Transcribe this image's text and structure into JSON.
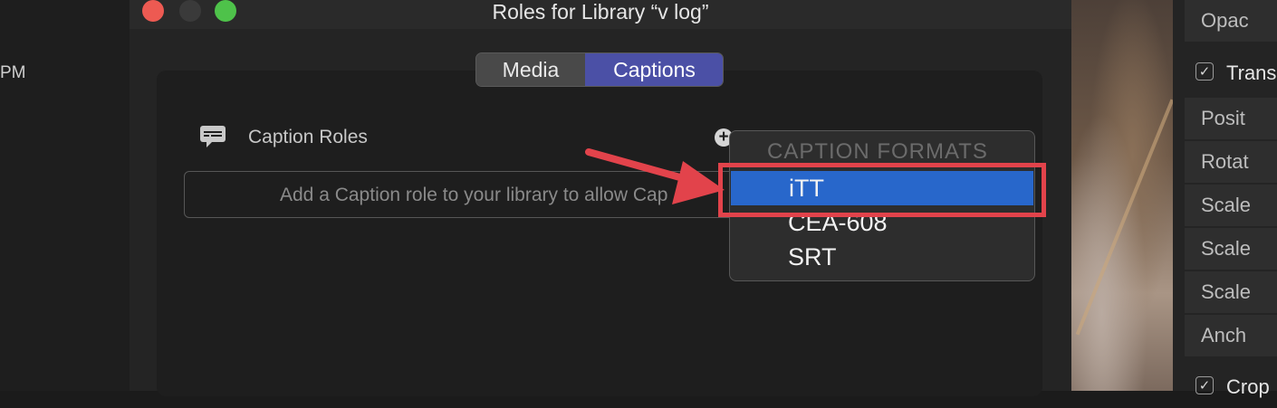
{
  "left_strip": {
    "time_fragment": "PM"
  },
  "dialog": {
    "title": "Roles for Library “v log”",
    "tabs": [
      {
        "label": "Media",
        "selected": false
      },
      {
        "label": "Captions",
        "selected": true
      }
    ],
    "caption_roles": {
      "label": "Caption Roles",
      "icon": "caption-bubble-icon",
      "add_icon": "plus-circle-icon",
      "placeholder": "Add a Caption role to your library to allow Cap"
    },
    "menu": {
      "header": "CAPTION FORMATS",
      "items": [
        {
          "label": "iTT",
          "highlighted": true
        },
        {
          "label": "CEA-608",
          "highlighted": false
        },
        {
          "label": "SRT",
          "highlighted": false
        }
      ]
    }
  },
  "inspector": {
    "rows": [
      {
        "label": "Opac",
        "kind": "row"
      },
      {
        "label": "Trans",
        "kind": "section",
        "checked": true
      },
      {
        "label": "Posit",
        "kind": "row"
      },
      {
        "label": "Rotat",
        "kind": "row"
      },
      {
        "label": "Scale",
        "kind": "row"
      },
      {
        "label": "Scale",
        "kind": "row"
      },
      {
        "label": "Scale",
        "kind": "row"
      },
      {
        "label": "Anch",
        "kind": "row"
      },
      {
        "label": "Crop",
        "kind": "section",
        "checked": true
      }
    ]
  },
  "colors": {
    "selection_blue": "#2867cb",
    "segment_active": "#4b50a6",
    "annotation_red": "#e2434b"
  }
}
